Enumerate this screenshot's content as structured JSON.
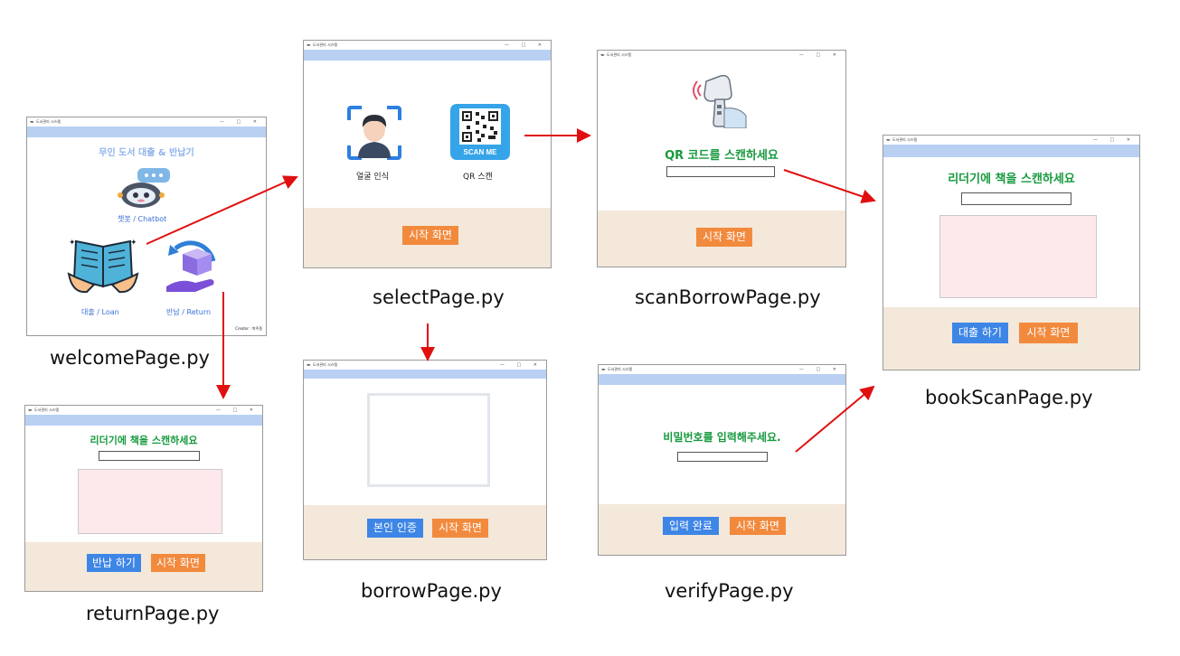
{
  "window_title": "도서관리 시스템",
  "window_controls": "—  □  ✕",
  "welcome": {
    "caption": "welcomePage.py",
    "title": "무인 도서 대출 & 반납기",
    "chatbot_label": "챗봇 / Chatbot",
    "loan_label": "대출 / Loan",
    "return_label": "반납 / Return",
    "creator_label": "Creator : 박주종"
  },
  "select": {
    "caption": "selectPage.py",
    "face_label": "얼굴 인식",
    "qr_label": "QR 스캔",
    "qr_badge": "SCAN ME",
    "home_button": "시작 화면"
  },
  "scan_borrow": {
    "caption": "scanBorrowPage.py",
    "prompt": "QR 코드를 스캔하세요",
    "home_button": "시작 화면"
  },
  "book_scan": {
    "caption": "bookScanPage.py",
    "prompt": "리더기에 책을 스캔하세요",
    "borrow_button": "대출 하기",
    "home_button": "시작 화면"
  },
  "return_page": {
    "caption": "returnPage.py",
    "prompt": "리더기에 책을 스캔하세요",
    "return_button": "반납 하기",
    "home_button": "시작 화면"
  },
  "borrow": {
    "caption": "borrowPage.py",
    "verify_button": "본인 인증",
    "home_button": "시작 화면"
  },
  "verify": {
    "caption": "verifyPage.py",
    "prompt": "비밀번호를 입력해주세요.",
    "submit_button": "입력 완료",
    "home_button": "시작 화면"
  },
  "colors": {
    "header_blue": "#b9d0f3",
    "footer_beige": "#f3e8da",
    "button_orange": "#f28a3e",
    "button_blue": "#3e86e6",
    "prompt_green": "#179a3e",
    "arrow_red": "#e01010"
  }
}
